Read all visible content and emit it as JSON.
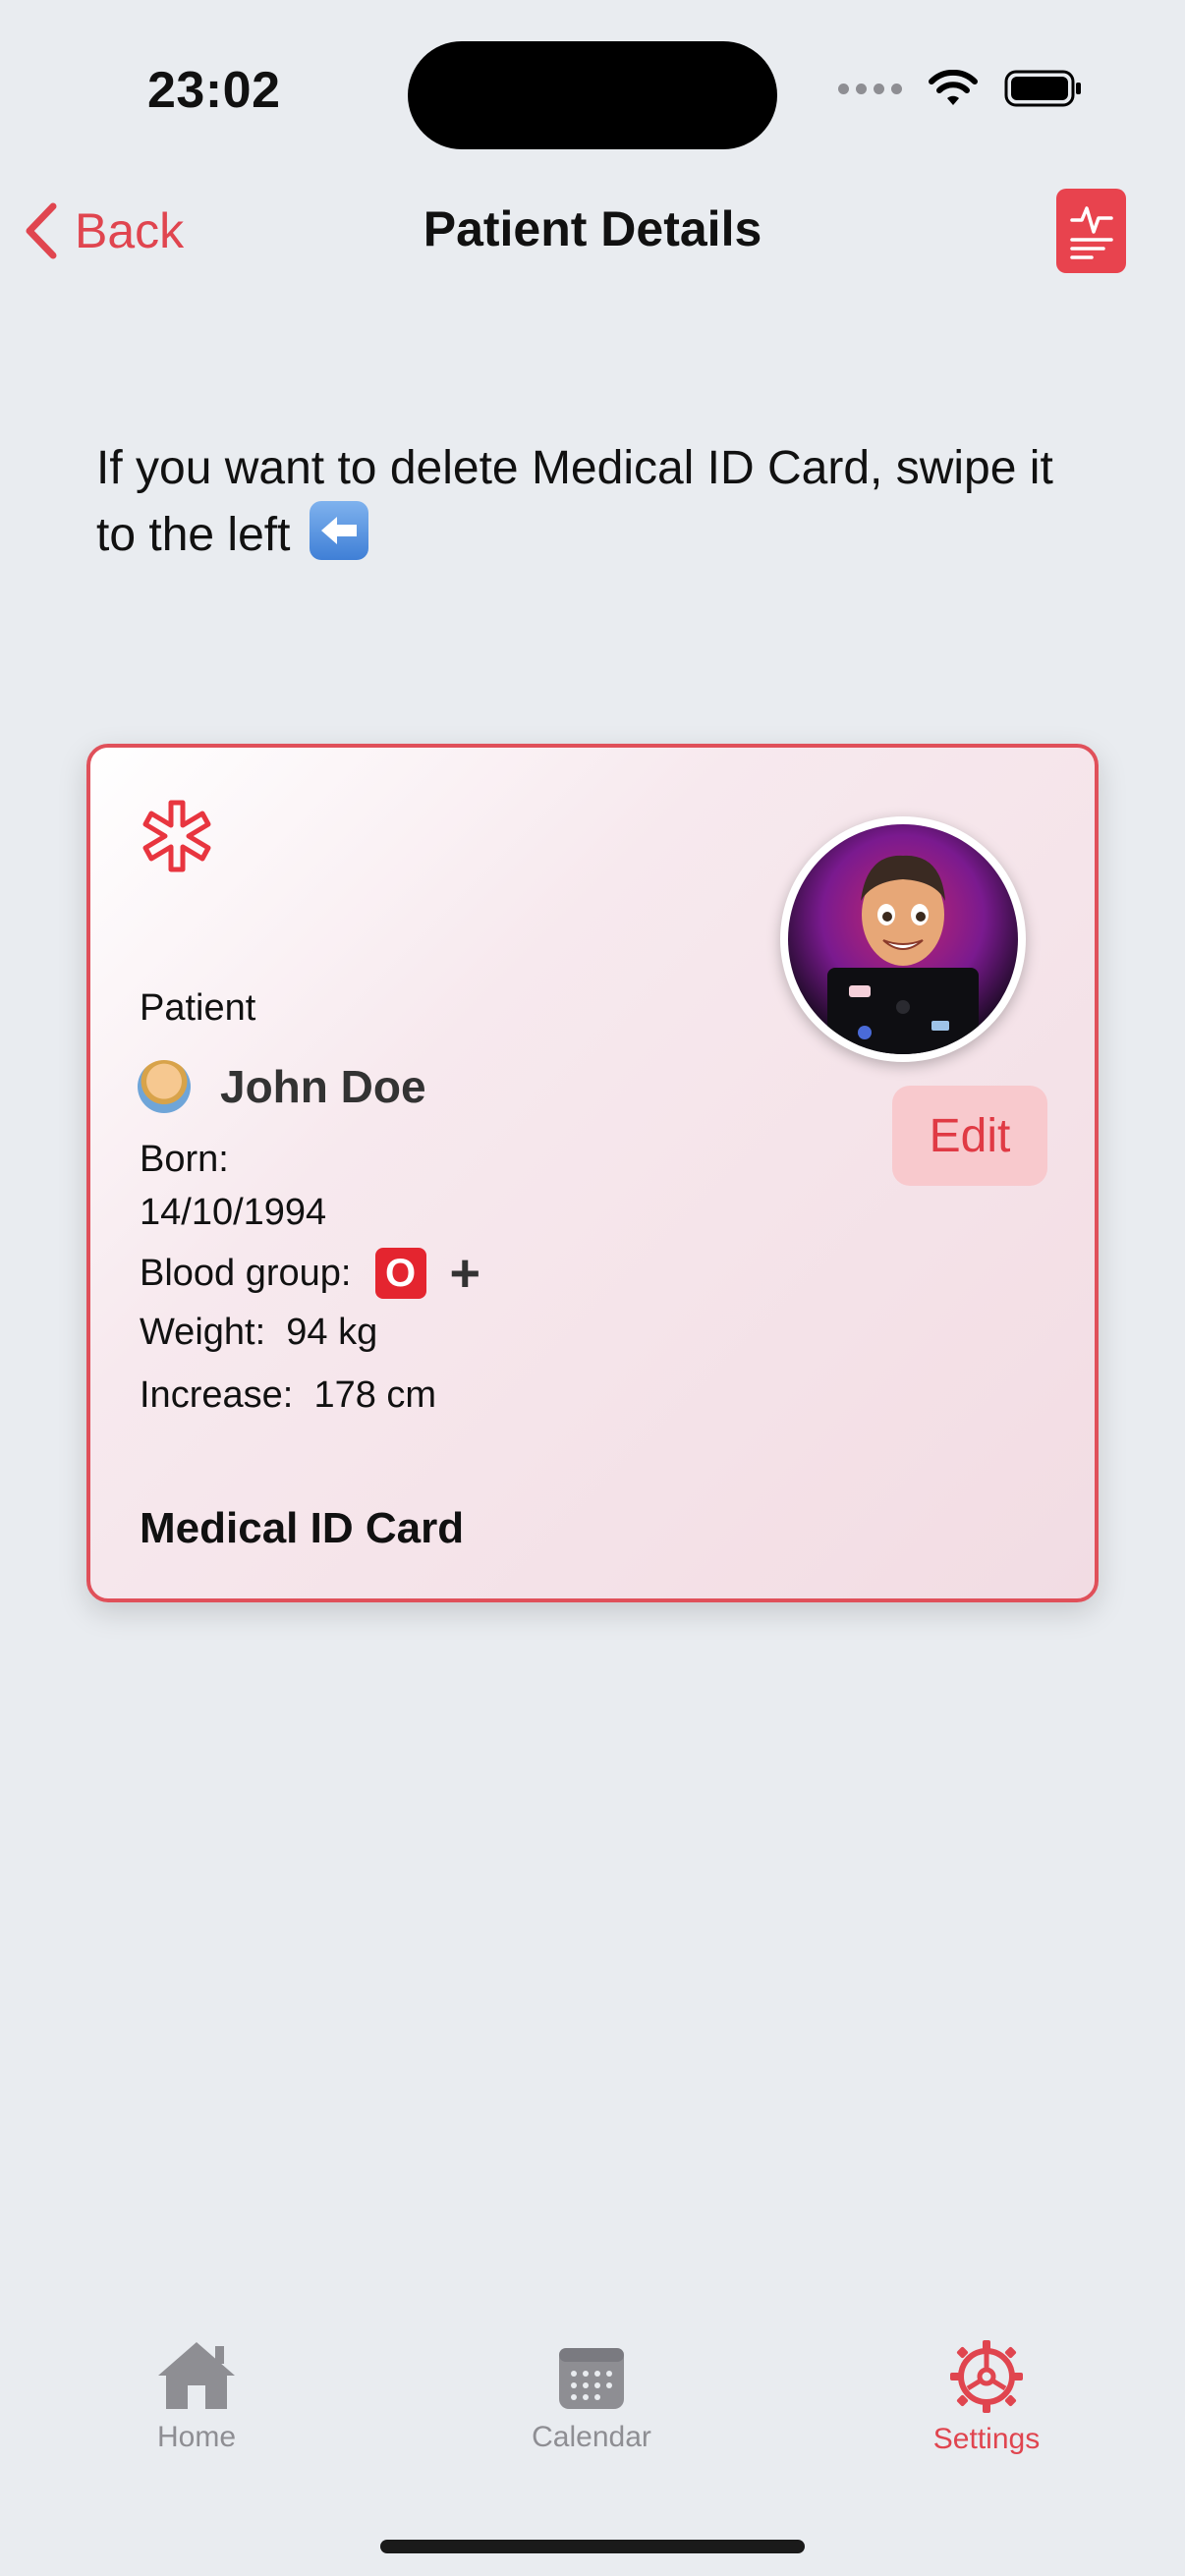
{
  "status": {
    "time": "23:02"
  },
  "nav": {
    "back_label": "Back",
    "title": "Patient Details",
    "action_icon": "medical-report-icon"
  },
  "hint": {
    "text": "If you want to delete Medical ID Card, swipe it to the left",
    "emoji": "left-arrow-emoji"
  },
  "card": {
    "patient_label": "Patient",
    "name": "John Doe",
    "born_label": "Born:",
    "born_value": "14/10/1994",
    "blood_label": "Blood group:",
    "blood_type": "O",
    "blood_rh": "+",
    "weight_label": "Weight:",
    "weight_value": "94 kg",
    "height_label": "Increase:",
    "height_value": "178 cm",
    "edit_label": "Edit",
    "title": "Medical ID Card"
  },
  "tabs": [
    {
      "label": "Home",
      "icon": "house-icon",
      "active": false
    },
    {
      "label": "Calendar",
      "icon": "calendar-icon",
      "active": false
    },
    {
      "label": "Settings",
      "icon": "gear-icon",
      "active": true
    }
  ],
  "colors": {
    "accent": "#E0454F",
    "background": "#E9ECF0",
    "card_border": "#E0505A",
    "edit_bg": "#F8C9CD"
  }
}
